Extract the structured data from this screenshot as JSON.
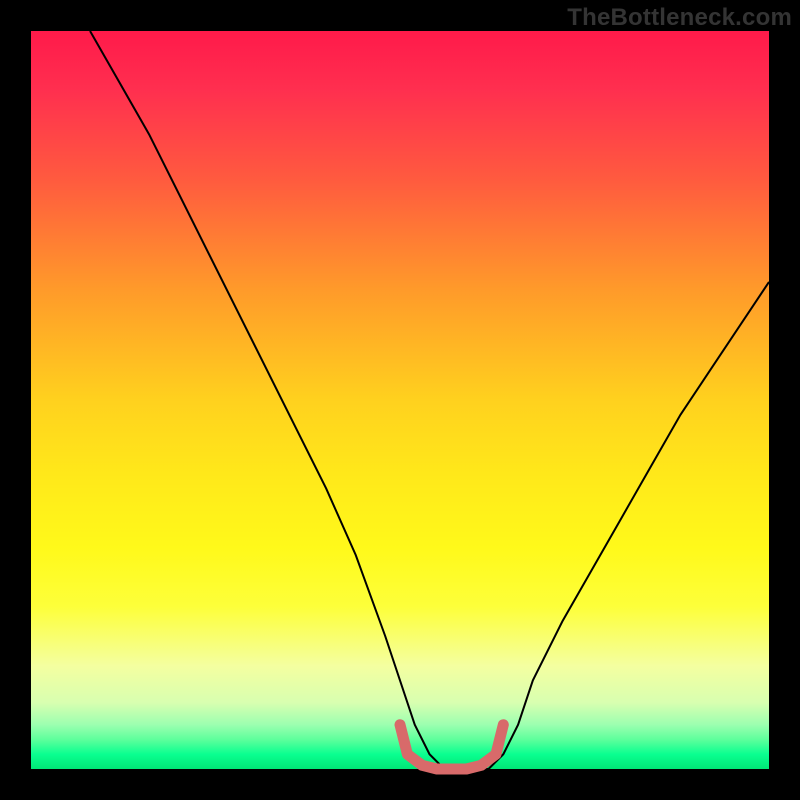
{
  "watermark": "TheBottleneck.com",
  "chart_data": {
    "type": "line",
    "title": "",
    "xlabel": "",
    "ylabel": "",
    "xlim": [
      0,
      100
    ],
    "ylim": [
      0,
      100
    ],
    "series": [
      {
        "name": "bottleneck-curve",
        "x": [
          8,
          12,
          16,
          20,
          24,
          28,
          32,
          36,
          40,
          44,
          48,
          50,
          52,
          54,
          56,
          58,
          60,
          62,
          64,
          66,
          68,
          72,
          76,
          80,
          84,
          88,
          92,
          96,
          100
        ],
        "values": [
          100,
          93,
          86,
          78,
          70,
          62,
          54,
          46,
          38,
          29,
          18,
          12,
          6,
          2,
          0,
          0,
          0,
          0,
          2,
          6,
          12,
          20,
          27,
          34,
          41,
          48,
          54,
          60,
          66
        ],
        "color": "#000000"
      },
      {
        "name": "optimal-zone-marker",
        "x": [
          50,
          51,
          53,
          55,
          57,
          59,
          61,
          63,
          64
        ],
        "values": [
          6,
          2,
          0.5,
          0,
          0,
          0,
          0.5,
          2,
          6
        ],
        "color": "#d86a6a"
      }
    ],
    "colors": {
      "gradient_top": "#ff1a4a",
      "gradient_mid": "#ffe81a",
      "gradient_bottom": "#00e676",
      "curve": "#000000",
      "marker": "#d86a6a"
    }
  }
}
